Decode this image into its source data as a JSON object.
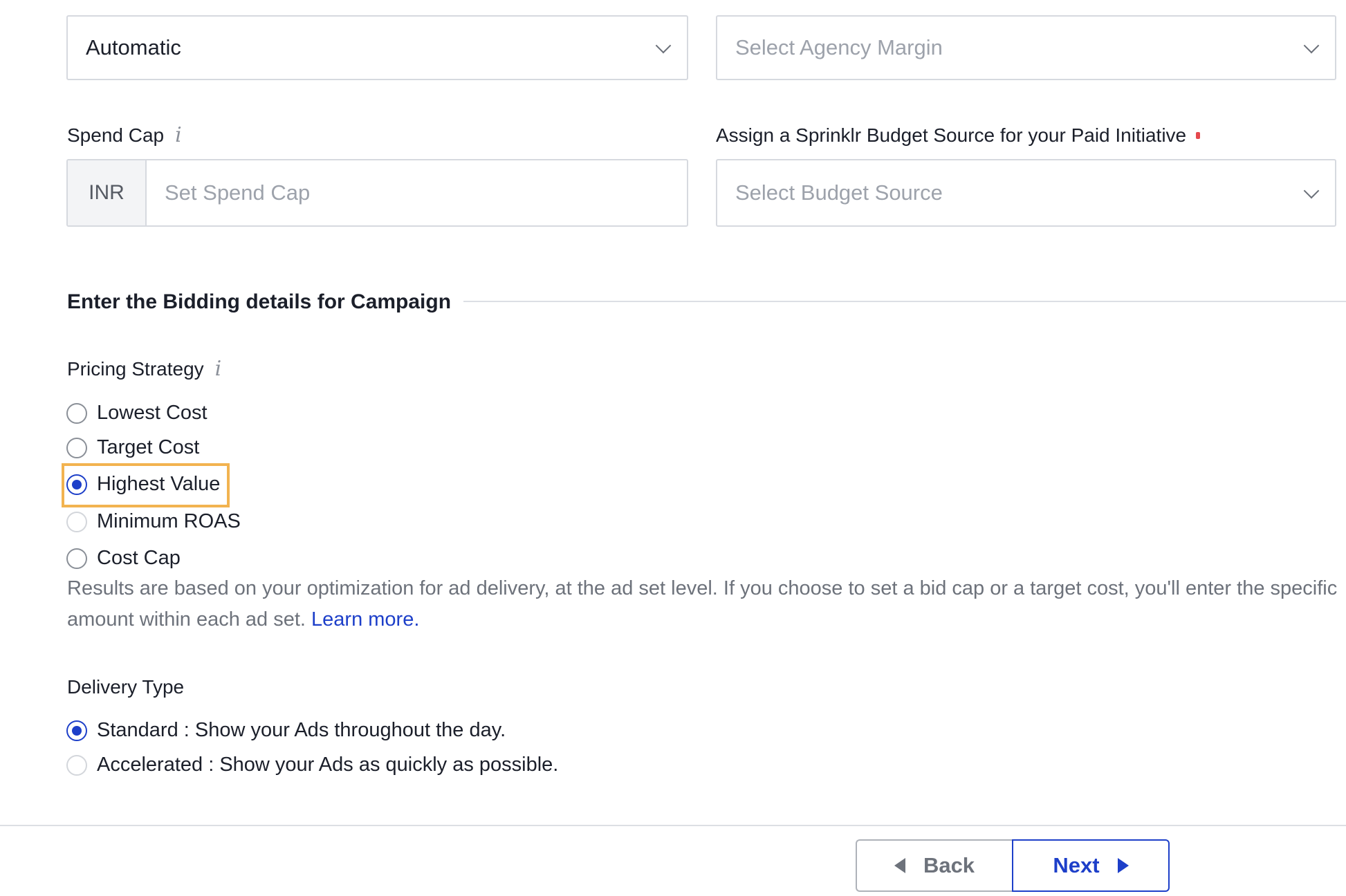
{
  "top_row": {
    "left_select_value": "Automatic",
    "right_select_placeholder": "Select Agency Margin"
  },
  "spend_cap": {
    "label": "Spend Cap",
    "currency": "INR",
    "placeholder": "Set Spend Cap"
  },
  "budget_source": {
    "label": "Assign a Sprinklr Budget Source for your Paid Initiative",
    "placeholder": "Select Budget Source"
  },
  "bidding": {
    "section_title": "Enter the Bidding details for Campaign",
    "pricing_label": "Pricing Strategy",
    "options": [
      {
        "label": "Lowest Cost",
        "checked": false
      },
      {
        "label": "Target Cost",
        "checked": false
      },
      {
        "label": "Highest Value",
        "checked": true
      },
      {
        "label": "Minimum ROAS",
        "checked": false
      },
      {
        "label": "Cost Cap",
        "checked": false
      }
    ],
    "help_text": "Results are based on your optimization for ad delivery, at the ad set level. If you choose to set a bid cap or a target cost, you'll enter the specific amount within each ad set.",
    "learn_more": "Learn more."
  },
  "delivery": {
    "label": "Delivery Type",
    "options": [
      {
        "label": "Standard : Show your Ads throughout the day.",
        "checked": true
      },
      {
        "label": "Accelerated : Show your Ads as quickly as possible.",
        "checked": false
      }
    ]
  },
  "footer": {
    "back_label": "Back",
    "next_label": "Next"
  },
  "colors": {
    "accent": "#1d3fc9",
    "highlight": "#f2b350",
    "required": "#e5484d"
  }
}
